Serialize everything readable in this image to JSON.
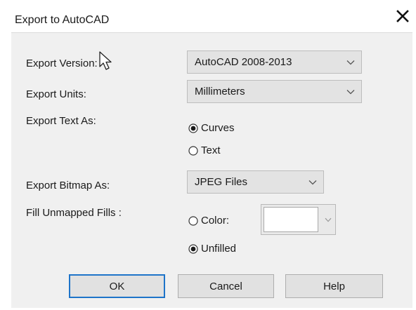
{
  "dialog": {
    "title": "Export to AutoCAD",
    "close_icon": "close-icon"
  },
  "form": {
    "export_version": {
      "label": "Export Version:",
      "value": "AutoCAD 2008-2013"
    },
    "export_units": {
      "label": "Export Units:",
      "value": "Millimeters"
    },
    "export_text_as": {
      "label": "Export Text As:",
      "options": [
        {
          "label": "Curves",
          "selected": true
        },
        {
          "label": "Text",
          "selected": false
        }
      ]
    },
    "export_bitmap_as": {
      "label": "Export Bitmap As:",
      "value": "JPEG Files"
    },
    "fill_unmapped_fills": {
      "label": "Fill Unmapped Fills :",
      "options": [
        {
          "label": "Color:",
          "selected": false
        },
        {
          "label": "Unfilled",
          "selected": true
        }
      ],
      "color_swatch": "#ffffff"
    }
  },
  "buttons": {
    "ok": "OK",
    "cancel": "Cancel",
    "help": "Help"
  },
  "colors": {
    "panel_background": "#f0f0f0",
    "combo_background": "#e3e3e3",
    "default_button_border": "#1e74c9"
  },
  "icons": {
    "dropdown": "chevron-down-icon",
    "cursor": "mouse-pointer-icon"
  }
}
